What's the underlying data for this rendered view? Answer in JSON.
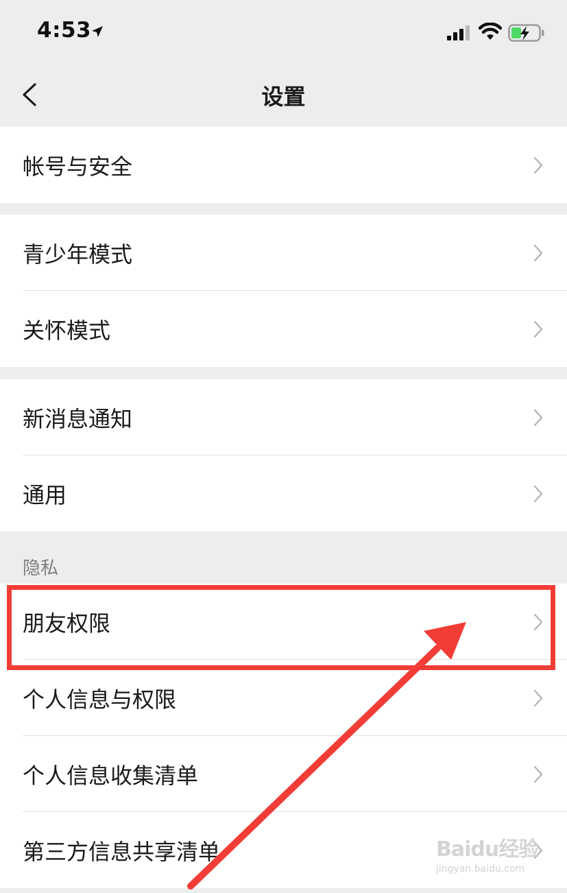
{
  "status_bar": {
    "time": "4:53"
  },
  "nav": {
    "title": "设置"
  },
  "groups": [
    {
      "items": [
        {
          "label": "帐号与安全"
        }
      ]
    },
    {
      "items": [
        {
          "label": "青少年模式"
        },
        {
          "label": "关怀模式"
        }
      ]
    },
    {
      "items": [
        {
          "label": "新消息通知"
        },
        {
          "label": "通用"
        }
      ]
    },
    {
      "header": "隐私",
      "items": [
        {
          "label": "朋友权限"
        },
        {
          "label": "个人信息与权限"
        },
        {
          "label": "个人信息收集清单"
        },
        {
          "label": "第三方信息共享清单"
        }
      ]
    }
  ],
  "annotation": {
    "highlighted_item": "朋友权限",
    "color": "#f23d37"
  },
  "watermark": {
    "logo": "Baidu经验",
    "url": "jingyan.baidu.com"
  },
  "colors": {
    "background": "#ededed",
    "row_background": "#ffffff",
    "text": "#191919",
    "secondary_text": "#7f7f7f",
    "battery_green": "#4cd964"
  }
}
